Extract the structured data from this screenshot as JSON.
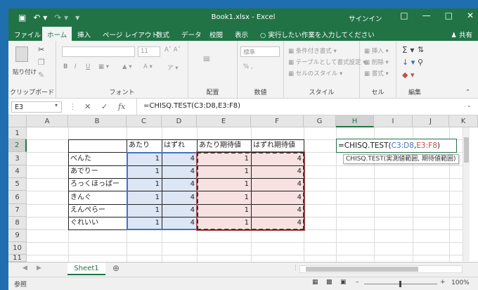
{
  "titlebar": {
    "title": "Book1.xlsx - Excel",
    "signin": "サインイン",
    "save_icon": "floppy-disk-icon",
    "undo_icon": "undo-arrow-icon",
    "redo_icon": "redo-arrow-icon"
  },
  "tabs": [
    {
      "label": "ファイル",
      "active": false
    },
    {
      "label": "ホーム",
      "active": true
    },
    {
      "label": "挿入",
      "active": false
    },
    {
      "label": "ページ レイアウト",
      "active": false
    },
    {
      "label": "数式",
      "active": false
    },
    {
      "label": "データ",
      "active": false
    },
    {
      "label": "校閲",
      "active": false
    },
    {
      "label": "表示",
      "active": false
    }
  ],
  "tell_me": "実行したい作業を入力してください",
  "share": "共有",
  "ribbon": {
    "clipboard": {
      "label": "クリップボード",
      "paste": "貼り付け"
    },
    "font": {
      "label": "フォント",
      "size": "11",
      "bold": "B",
      "italic": "I",
      "underline": "U"
    },
    "alignment": {
      "label": "配置"
    },
    "number": {
      "label": "数値",
      "format": "標準"
    },
    "styles": {
      "label": "スタイル",
      "conditional": "条件付き書式",
      "table": "テーブルとして書式設定",
      "cell_styles": "セルのスタイル"
    },
    "cells": {
      "label": "セル",
      "insert": "挿入",
      "delete": "削除",
      "format": "書式"
    },
    "editing": {
      "label": "編集"
    }
  },
  "formula_bar": {
    "namebox": "E3",
    "cancel": "✕",
    "enter": "✓",
    "fx": "fx",
    "formula": "=CHISQ.TEST(C3:D8,E3:F8)"
  },
  "columns": [
    "A",
    "B",
    "C",
    "D",
    "E",
    "F",
    "G",
    "H",
    "I",
    "J",
    "K"
  ],
  "rows": [
    "1",
    "2",
    "3",
    "4",
    "5",
    "6",
    "7",
    "8",
    "9",
    "10",
    "11"
  ],
  "table": {
    "headers": [
      "あたり",
      "はずれ",
      "あたり期待値",
      "はずれ期待値"
    ],
    "labels": [
      "べんた",
      "あでりー",
      "ろっくほっぱー",
      "きんぐ",
      "えんぺらー",
      "ぐれいい"
    ],
    "values": [
      [
        1,
        4,
        1,
        4
      ],
      [
        1,
        4,
        1,
        4
      ],
      [
        1,
        4,
        1,
        4
      ],
      [
        1,
        4,
        1,
        4
      ],
      [
        1,
        4,
        1,
        4
      ],
      [
        1,
        4,
        1,
        4
      ]
    ]
  },
  "edit_cell": {
    "prefix": "=CHISQ.TEST(",
    "arg1": "C3:D8",
    "comma": ",",
    "arg2": "E3:F8",
    "suffix": ")"
  },
  "tooltip": "CHISQ.TEST(実測値範囲, 期待値範囲)",
  "sheet_tab": "Sheet1",
  "status": {
    "mode": "参照",
    "zoom": "100%"
  },
  "colors": {
    "excel_green": "#217346",
    "range_blue": "#4472c4",
    "range_red": "#c0504d"
  }
}
